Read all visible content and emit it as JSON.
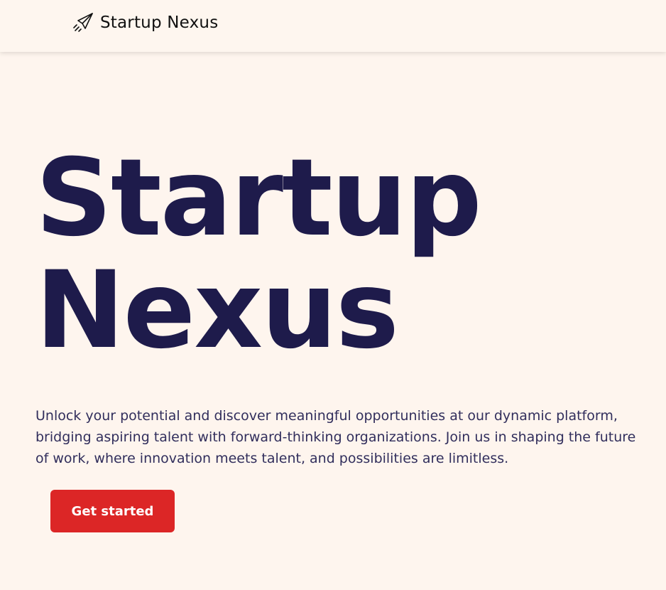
{
  "header": {
    "brand": {
      "icon": "paper-plane-icon",
      "name": "Startup Nexus"
    }
  },
  "hero": {
    "title_line1": "Startup",
    "title_line2": "Nexus",
    "description": "Unlock your potential and discover meaningful opportunities at our dynamic platform, bridging aspiring talent with forward-thinking organizations. Join us in shaping the future of work, where innovation meets talent, and possibilities are limitless.",
    "cta_label": "Get started"
  },
  "colors": {
    "background": "#fef5ee",
    "title": "#1e1b4b",
    "body_text": "#312e5c",
    "cta": "#dc2626"
  }
}
